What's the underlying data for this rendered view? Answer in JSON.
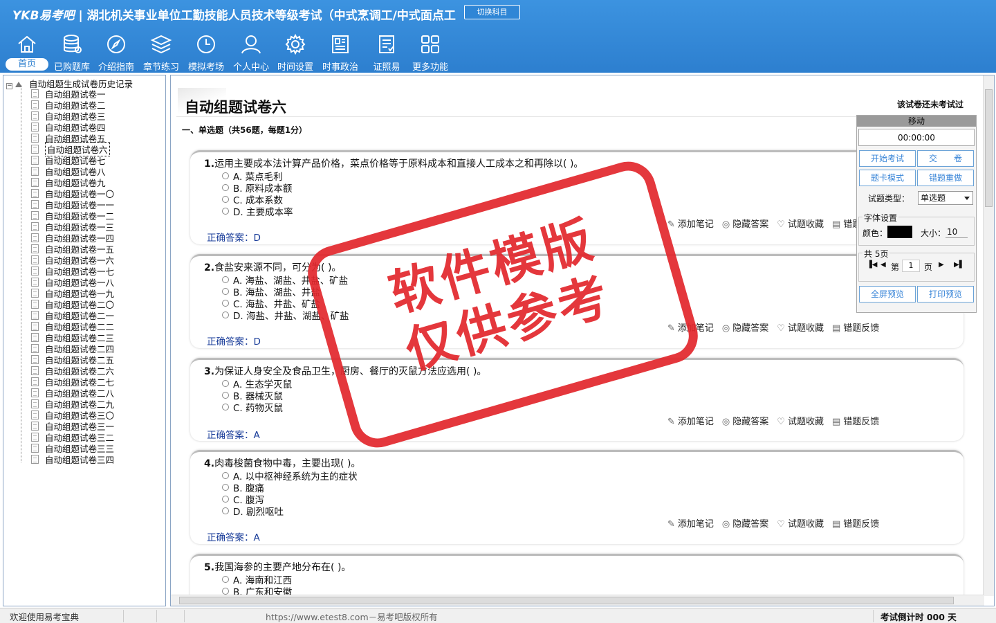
{
  "header": {
    "brand": "YKB易考吧",
    "title": "湖北机关事业单位工勤技能人员技术等级考试（中式烹调工/中式面点工",
    "switch_label": "切换科目"
  },
  "nav": [
    {
      "label": "首页",
      "icon": "home-icon"
    },
    {
      "label": "已购题库",
      "icon": "database-icon"
    },
    {
      "label": "介绍指南",
      "icon": "compass-icon"
    },
    {
      "label": "章节练习",
      "icon": "layers-icon"
    },
    {
      "label": "模拟考场",
      "icon": "clock-icon"
    },
    {
      "label": "个人中心",
      "icon": "user-icon"
    },
    {
      "label": "时间设置",
      "icon": "gear-icon"
    },
    {
      "label": "时事政治",
      "icon": "newspaper-icon"
    },
    {
      "label": "证照易",
      "icon": "certificate-icon"
    },
    {
      "label": "更多功能",
      "icon": "grid-icon"
    }
  ],
  "tree": {
    "root": "自动组题生成试卷历史记录",
    "items": [
      "自动组题试卷一",
      "自动组题试卷二",
      "自动组题试卷三",
      "自动组题试卷四",
      "自动组题试卷五",
      "自动组题试卷六",
      "自动组题试卷七",
      "自动组题试卷八",
      "自动组题试卷九",
      "自动组题试卷一〇",
      "自动组题试卷一一",
      "自动组题试卷一二",
      "自动组题试卷一三",
      "自动组题试卷一四",
      "自动组题试卷一五",
      "自动组题试卷一六",
      "自动组题试卷一七",
      "自动组题试卷一八",
      "自动组题试卷一九",
      "自动组题试卷二〇",
      "自动组题试卷二一",
      "自动组题试卷二二",
      "自动组题试卷二三",
      "自动组题试卷二四",
      "自动组题试卷二五",
      "自动组题试卷二六",
      "自动组题试卷二七",
      "自动组题试卷二八",
      "自动组题试卷二九",
      "自动组题试卷三〇",
      "自动组题试卷三一",
      "自动组题试卷三二",
      "自动组题试卷三三",
      "自动组题试卷三四"
    ],
    "selected": "自动组题试卷六"
  },
  "exam": {
    "title": "自动组题试卷六",
    "status": "该试卷还未考试过",
    "section": "一、单选题（共56题，每题1分）",
    "answer_prefix": "正确答案：",
    "questions": [
      {
        "num": "1.",
        "text": "运用主要成本法计算产品价格，菜点价格等于原料成本和直接人工成本之和再除以(  )。",
        "options": [
          "A. 菜点毛利",
          "B. 原料成本额",
          "C. 成本系数",
          "D. 主要成本率"
        ],
        "answer": "D"
      },
      {
        "num": "2.",
        "text": "食盐安来源不同，可分为(    )。",
        "options": [
          "A. 海盐、湖盐、井盐、矿盐",
          "B. 海盐、湖盐、井盐",
          "C. 海盐、井盐、矿盐",
          "D. 海盐、井盐、湖盐、矿盐"
        ],
        "answer": "D"
      },
      {
        "num": "3.",
        "text": "为保证人身安全及食品卫生，厨房、餐厅的灭鼠方法应选用(  )。",
        "options": [
          "A. 生态学灭鼠",
          "B. 器械灭鼠",
          "C. 药物灭鼠"
        ],
        "answer": "A"
      },
      {
        "num": "4.",
        "text": "肉毒梭菌食物中毒，主要出现(  )。",
        "options": [
          "A. 以中枢神经系统为主的症状",
          "B. 腹痛",
          "C. 腹泻",
          "D. 剧烈呕吐"
        ],
        "answer": "A"
      },
      {
        "num": "5.",
        "text": "我国海参的主要产地分布在(  )。",
        "options": [
          "A. 海南和江西",
          "B. 广东和安徽"
        ],
        "answer": ""
      }
    ],
    "actions": [
      "添加笔记",
      "隐藏答案",
      "试题收藏",
      "错题反馈"
    ]
  },
  "panel": {
    "move": "移动",
    "timer": "00:00:00",
    "start": "开始考试",
    "submit": "交　　卷",
    "card_mode": "题卡模式",
    "redo": "错题重做",
    "type_label": "试题类型：",
    "type_value": "单选题",
    "font_label": "字体设置",
    "color_label": "颜色：",
    "size_label": "大小：",
    "size_value": "10",
    "pages_label": "共 5页",
    "page_prefix": "第",
    "page_value": "1",
    "page_suffix": "页",
    "fullscreen": "全屏预览",
    "print": "打印预览"
  },
  "status": {
    "welcome": "欢迎使用易考宝典",
    "copyright": "https://www.etest8.com－易考吧版权所有",
    "countdown": "考试倒计时 000 天"
  },
  "watermark": {
    "line1": "软件模版",
    "line2": "仅供参考"
  },
  "colors": {
    "topbar": "#2d7fcf",
    "stamp": "#e2272c",
    "answer": "#1a3d9a",
    "button": "#3a86d8"
  }
}
